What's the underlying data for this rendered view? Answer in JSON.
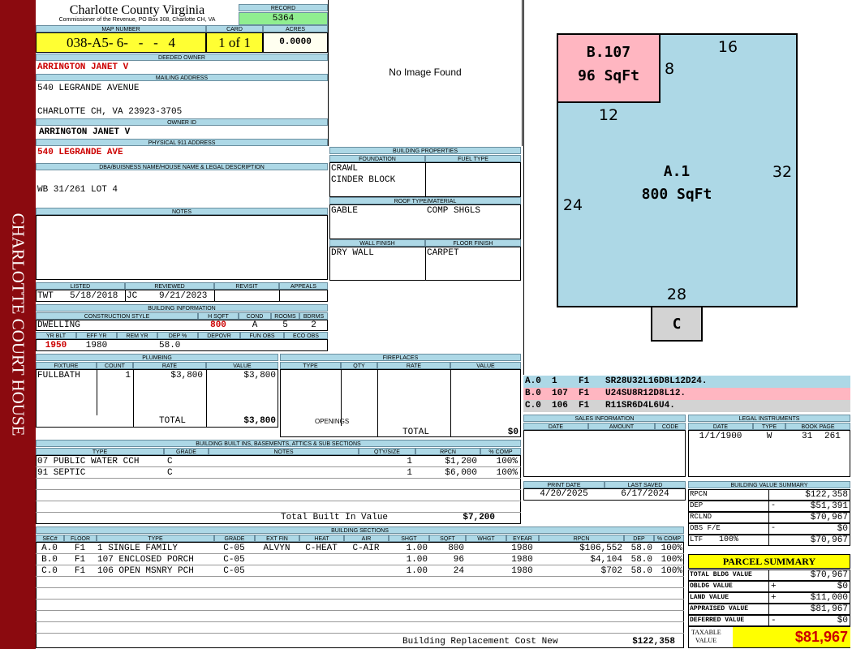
{
  "sidebar": {
    "title": "CHARLOTTE COURT HOUSE"
  },
  "header": {
    "county": "Charlotte County Virginia",
    "address": "Commissioner of the Revenue, PO Box 308, Charlotte CH, VA",
    "record_label": "RECORD",
    "record": "5364"
  },
  "ids": {
    "map_label": "MAP NUMBER",
    "map": "038-A5- 6-   -   -   4",
    "card_label": "CARD",
    "card": "1 of 1",
    "acres_label": "ACRES",
    "acres": "0.0000"
  },
  "owner": {
    "deeded_label": "DEEDED OWNER",
    "deeded": "ARRINGTON JANET V",
    "mailing_label": "MAILING ADDRESS",
    "mail1": "540 LEGRANDE AVENUE",
    "mail2": "CHARLOTTE CH, VA 23923-3705",
    "owner_id_label": "OWNER ID",
    "owner_id": "ARRINGTON JANET V",
    "phys_label": "PHYSICAL 911 ADDRESS",
    "phys": "540 LEGRANDE AVE"
  },
  "legal": {
    "label": "DBA/BUISNESS NAME/HOUSE NAME & LEGAL DESCRIPTION",
    "text": "WB 31/261 LOT 4"
  },
  "notes": {
    "label": "NOTES"
  },
  "photo": {
    "text": "No Image Found"
  },
  "props": {
    "title": "BUILDING PROPERTIES",
    "foundation_label": "FOUNDATION",
    "fuel_label": "FUEL TYPE",
    "foundation1": "CRAWL",
    "foundation2": "CINDER BLOCK",
    "roof_label": "ROOF TYPE/MATERIAL",
    "roof1": "GABLE",
    "roof2": "COMP SHGLS",
    "wall_label": "WALL FINISH",
    "floor_label": "FLOOR FINISH",
    "wall": "DRY WALL",
    "floor": "CARPET"
  },
  "listed": {
    "h": [
      "LISTED",
      "REVIEWED",
      "REVISIT",
      "APPEALS"
    ],
    "l_by": "TWT",
    "l_date": "5/18/2018",
    "r_by": "JC",
    "r_date": "9/21/2023"
  },
  "bldg_info": {
    "title": "BUILDING INFORMATION",
    "h1": [
      "CONSTRUCTION STYLE",
      "H SQFT",
      "COND",
      "ROOMS",
      "BDRMS"
    ],
    "style": "DWELLING",
    "hsqft": "800",
    "cond": "A",
    "rooms": "5",
    "bdrms": "2",
    "h2": [
      "YR BLT",
      "EFF YR",
      "REM YR",
      "DEP %",
      "DEPOVR",
      "FUN OBS",
      "ECO OBS"
    ],
    "yrblt": "1950",
    "effyr": "1980",
    "dep": "58.0"
  },
  "plumbing": {
    "title": "PLUMBING",
    "h": [
      "FIXTURE",
      "COUNT",
      "RATE",
      "VALUE"
    ],
    "rows": [
      [
        "FULLBATH",
        "1",
        "$3,800",
        "$3,800"
      ]
    ],
    "total_label": "TOTAL",
    "total": "$3,800"
  },
  "fireplaces": {
    "title": "FIREPLACES",
    "h": [
      "TYPE",
      "QTY",
      "RATE",
      "VALUE"
    ],
    "openings": "OPENINGS",
    "total_label": "TOTAL",
    "total": "$0"
  },
  "builtins": {
    "title": "BUILDING BUILT INS, BASEMENTS, ATTICS & SUB SECTIONS",
    "h": [
      "TYPE",
      "GRADE",
      "NOTES",
      "QTY/SIZE",
      "RPCN",
      "% COMP"
    ],
    "rows": [
      [
        "07 PUBLIC WATER CCH",
        "C",
        "",
        "1",
        "$1,200",
        "100%"
      ],
      [
        "91 SEPTIC",
        "C",
        "",
        "1",
        "$6,000",
        "100%"
      ]
    ],
    "total_label": "Total Built In Value",
    "total": "$7,200"
  },
  "sketch": {
    "a_label": "A.1",
    "a_area": "800 SqFt",
    "b_label": "B.107",
    "b_area": "96 SqFt",
    "c_label": "C",
    "dims": [
      "16",
      "8",
      "12",
      "32",
      "24",
      "28"
    ],
    "colors": {
      "main": "#add8e6",
      "porch": "#ffb6c1",
      "patio": "#d3d3d3"
    }
  },
  "vectors": [
    {
      "t": "A.0  1    F1   SR28U32L16D8L12D24.",
      "bg": "#add8e6"
    },
    {
      "t": "B.0  107  F1   U24SU8R12D8L12.",
      "bg": "#ffb6c1"
    },
    {
      "t": "C.0  106  F1   R11SR6D4L6U4.",
      "bg": "#d3d3d3"
    }
  ],
  "sales": {
    "title": "SALES INFORMATION",
    "h": [
      "DATE",
      "AMOUNT",
      "CODE"
    ]
  },
  "instr": {
    "title": "LEGAL INSTRUMENTS",
    "h": [
      "DATE",
      "TYPE",
      "BOOK PAGE"
    ],
    "date": "1/1/1900",
    "type": "W",
    "book": "31",
    "page": "261"
  },
  "dates": {
    "print_label": "PRINT DATE",
    "saved_label": "LAST SAVED",
    "print": "4/20/2025",
    "saved": "6/17/2024"
  },
  "bvs": {
    "title": "BUILDING VALUE SUMMARY",
    "rows": [
      [
        "RPCN",
        "",
        "$122,358"
      ],
      [
        "DEP",
        "-",
        "$51,391"
      ],
      [
        "RCLND",
        "",
        "$70,967"
      ],
      [
        "OBS F/E",
        "-",
        "$0"
      ],
      [
        "LTF",
        "100%",
        "$70,967"
      ]
    ]
  },
  "parcel": {
    "title": "PARCEL SUMMARY",
    "rows": [
      [
        "TOTAL BLDG VALUE",
        "",
        "$70,967"
      ],
      [
        "OBLDG VALUE",
        "+",
        "$0"
      ],
      [
        "LAND VALUE",
        "+",
        "$11,000"
      ],
      [
        "APPRAISED VALUE",
        "",
        "$81,967"
      ],
      [
        "DEFERRED VALUE",
        "-",
        "$0"
      ]
    ],
    "taxable_label1": "TAXABLE",
    "taxable_label2": "VALUE",
    "taxable": "$81,967"
  },
  "sections": {
    "title": "BUILDING SECTIONS",
    "h": [
      "SEC#",
      "FLOOR",
      "TYPE",
      "GRADE",
      "EXT FIN",
      "HEAT",
      "AIR",
      "SHGT",
      "SQFT",
      "WHGT",
      "EYEAR",
      "RPCN",
      "DEP",
      "% COMP"
    ],
    "rows": [
      [
        "A.0",
        "F1",
        "1 SINGLE FAMILY",
        "C-05",
        "ALVYN",
        "C-HEAT",
        "C-AIR",
        "1.00",
        "800",
        "",
        "1980",
        "$106,552",
        "58.0",
        "100%"
      ],
      [
        "B.0",
        "F1",
        "107 ENCLOSED PORCH",
        "C-05",
        "",
        "",
        "",
        "1.00",
        "96",
        "",
        "1980",
        "$4,104",
        "58.0",
        "100%"
      ],
      [
        "C.0",
        "F1",
        "106 OPEN MSNRY PCH",
        "C-05",
        "",
        "",
        "",
        "1.00",
        "24",
        "",
        "1980",
        "$702",
        "58.0",
        "100%"
      ]
    ],
    "total_label": "Building Replacement Cost New",
    "total": "$122,358"
  }
}
